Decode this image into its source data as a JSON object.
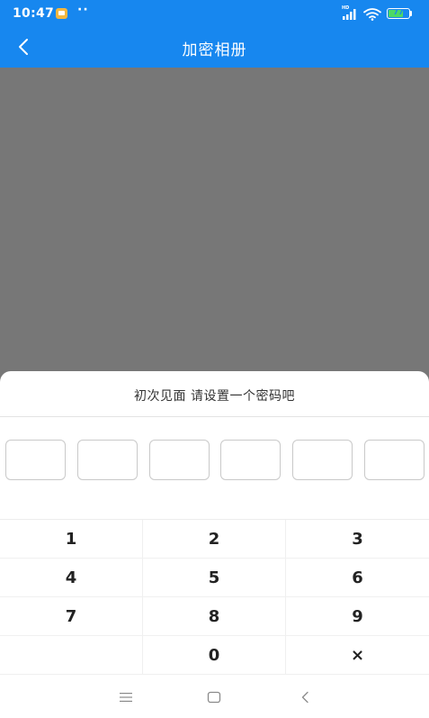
{
  "status_bar": {
    "time": "10:47",
    "dots": "··",
    "network": "HD",
    "battery": "77",
    "battery_level": 77
  },
  "title_bar": {
    "title": "加密相册"
  },
  "sheet": {
    "prompt": "初次见面 请设置一个密码吧",
    "pin_length": 6
  },
  "keypad": {
    "keys": [
      {
        "label": "1"
      },
      {
        "label": "2"
      },
      {
        "label": "3"
      },
      {
        "label": "4"
      },
      {
        "label": "5"
      },
      {
        "label": "6"
      },
      {
        "label": "7"
      },
      {
        "label": "8"
      },
      {
        "label": "9"
      },
      {
        "label": ""
      },
      {
        "label": "0"
      },
      {
        "label": "×"
      }
    ]
  },
  "nav_bar": {
    "items": [
      "menu-icon",
      "home-icon",
      "back-icon"
    ]
  },
  "colors": {
    "primary": "#1787ef",
    "overlay": "#777777",
    "battery": "#4cd964"
  }
}
